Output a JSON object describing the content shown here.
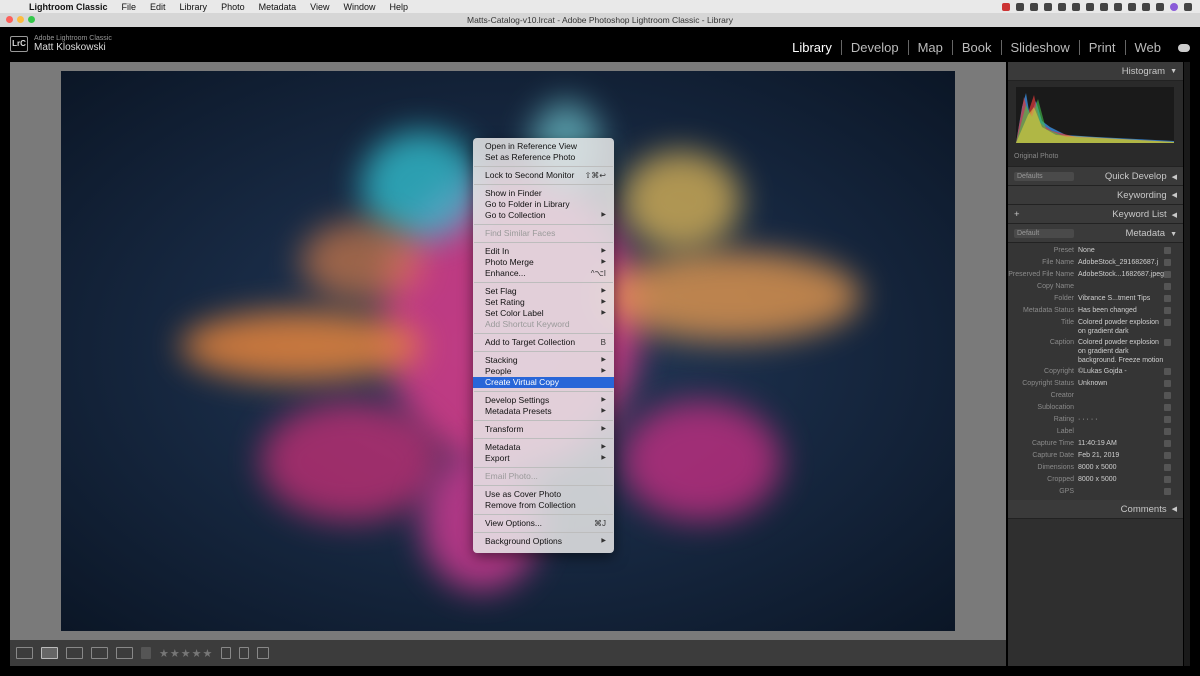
{
  "mac_menubar": {
    "items": [
      "Lightroom Classic",
      "File",
      "Edit",
      "Library",
      "Photo",
      "Metadata",
      "View",
      "Window",
      "Help"
    ]
  },
  "window": {
    "title": "Matts-Catalog-v10.lrcat - Adobe Photoshop Lightroom Classic - Library"
  },
  "identity": {
    "badge": "LrC",
    "product": "Adobe Lightroom Classic",
    "user": "Matt Kloskowski"
  },
  "modules": [
    "Library",
    "Develop",
    "Map",
    "Book",
    "Slideshow",
    "Print",
    "Web"
  ],
  "active_module": "Library",
  "context_menu": [
    {
      "label": "Open in Reference View"
    },
    {
      "label": "Set as Reference Photo"
    },
    {
      "sep": true
    },
    {
      "label": "Lock to Second Monitor",
      "shortcut": "⇧⌘↩"
    },
    {
      "sep": true
    },
    {
      "label": "Show in Finder"
    },
    {
      "label": "Go to Folder in Library"
    },
    {
      "label": "Go to Collection",
      "sub": true
    },
    {
      "sep": true
    },
    {
      "label": "Find Similar Faces",
      "disabled": true
    },
    {
      "sep": true
    },
    {
      "label": "Edit In",
      "sub": true
    },
    {
      "label": "Photo Merge",
      "sub": true
    },
    {
      "label": "Enhance...",
      "shortcut": "^⌥I"
    },
    {
      "sep": true
    },
    {
      "label": "Set Flag",
      "sub": true
    },
    {
      "label": "Set Rating",
      "sub": true
    },
    {
      "label": "Set Color Label",
      "sub": true
    },
    {
      "label": "Add Shortcut Keyword",
      "disabled": true
    },
    {
      "sep": true
    },
    {
      "label": "Add to Target Collection",
      "shortcut": "B"
    },
    {
      "sep": true
    },
    {
      "label": "Stacking",
      "sub": true
    },
    {
      "label": "People",
      "sub": true
    },
    {
      "label": "Create Virtual Copy",
      "highlight": true
    },
    {
      "sep": true
    },
    {
      "label": "Develop Settings",
      "sub": true
    },
    {
      "label": "Metadata Presets",
      "sub": true
    },
    {
      "sep": true
    },
    {
      "label": "Transform",
      "sub": true
    },
    {
      "sep": true
    },
    {
      "label": "Metadata",
      "sub": true
    },
    {
      "label": "Export",
      "sub": true
    },
    {
      "sep": true
    },
    {
      "label": "Email Photo...",
      "disabled": true
    },
    {
      "sep": true
    },
    {
      "label": "Use as Cover Photo"
    },
    {
      "label": "Remove from Collection"
    },
    {
      "sep": true
    },
    {
      "label": "View Options...",
      "shortcut": "⌘J"
    },
    {
      "sep": true
    },
    {
      "label": "Background Options",
      "sub": true
    }
  ],
  "right_panel": {
    "histogram": "Histogram",
    "original_photo": "Original Photo",
    "quick_develop": "Quick Develop",
    "quick_develop_preset": "Defaults",
    "keywording": "Keywording",
    "keyword_list": "Keyword List",
    "metadata": "Metadata",
    "metadata_preset_dd": "Default",
    "metadata_rows": [
      {
        "k": "Preset",
        "v": "None"
      },
      {
        "k": "File Name",
        "v": "AdobeStock_291682687.j"
      },
      {
        "k": "Preserved File Name",
        "v": "AdobeStock...1682687.jpeg"
      },
      {
        "k": "Copy Name",
        "v": ""
      },
      {
        "k": "Folder",
        "v": "Vibrance S...tment Tips"
      },
      {
        "k": "Metadata Status",
        "v": "Has been changed"
      },
      {
        "k": "Title",
        "v": "Colored powder explosion\non gradient dark"
      },
      {
        "k": "Caption",
        "v": "Colored powder explosion\non gradient dark\nbackground. Freeze motion"
      },
      {
        "k": "Copyright",
        "v": "©Lukas Gojda -"
      },
      {
        "k": "Copyright Status",
        "v": "Unknown"
      },
      {
        "k": "Creator",
        "v": ""
      },
      {
        "k": "Sublocation",
        "v": ""
      },
      {
        "k": "Rating",
        "v": "· · · · ·"
      },
      {
        "k": "Label",
        "v": ""
      },
      {
        "k": "Capture Time",
        "v": "11:40:19 AM"
      },
      {
        "k": "Capture Date",
        "v": "Feb 21, 2019"
      },
      {
        "k": "Dimensions",
        "v": "8000 x 5000"
      },
      {
        "k": "Cropped",
        "v": "8000 x 5000"
      },
      {
        "k": "GPS",
        "v": ""
      }
    ],
    "comments": "Comments"
  },
  "toolbar": {
    "stars": "★★★★★"
  },
  "colors": {
    "menu_highlight": "#2866d8",
    "photo_bg": "#182a44"
  }
}
